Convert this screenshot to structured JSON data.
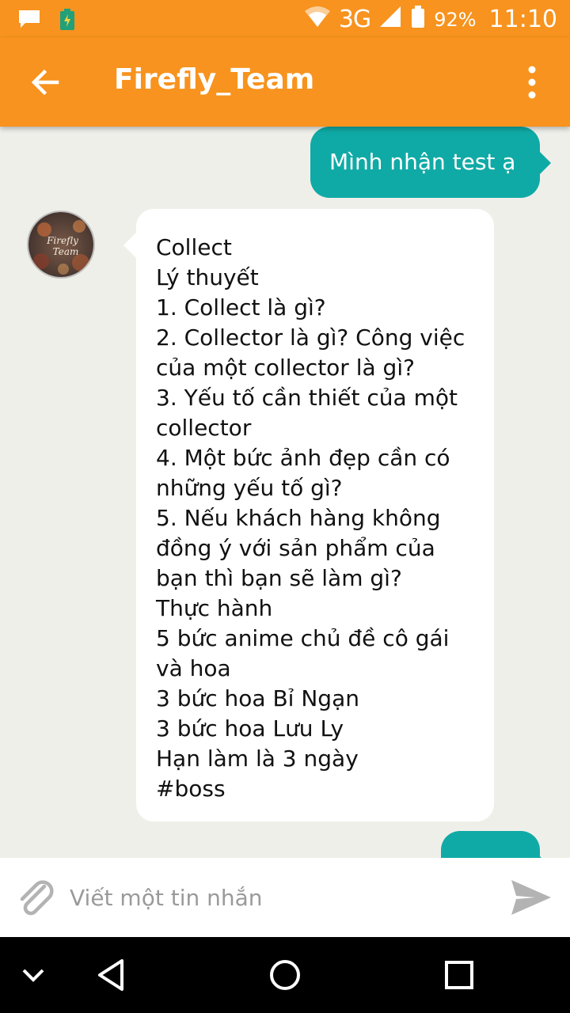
{
  "status_bar": {
    "network": "3G",
    "battery_percent": "92%",
    "time": "11:10",
    "icons": [
      "message-notification-icon",
      "battery-saver-icon",
      "wifi-icon",
      "signal-icon",
      "battery-icon"
    ]
  },
  "app_bar": {
    "title": "Firefly_Team",
    "back_icon": "arrow-left-icon",
    "menu_icon": "more-vertical-icon"
  },
  "messages": {
    "outgoing_1": "Mình nhận test ạ",
    "avatar_text": "Firefly Team",
    "incoming_lines": [
      "Collect",
      "Lý thuyết",
      "1. Collect là gì?",
      "2. Collector là gì? Công việc",
      "của một collector là gì?",
      "3. Yếu tố cần thiết của một",
      "collector",
      "4. Một bức ảnh đẹp cần có",
      "những yếu tố gì?",
      "5. Nếu khách hàng không",
      "đồng ý với sản phẩm của",
      "bạn thì bạn sẽ làm gì?",
      "Thực hành",
      "5 bức anime chủ đề cô gái",
      "và hoa",
      "3 bức hoa Bỉ Ngạn",
      "3 bức hoa Lưu Ly",
      "Hạn làm là 3 ngày",
      "#boss"
    ]
  },
  "composer": {
    "placeholder": "Viết một tin nhắn",
    "value": "",
    "attach_icon": "paperclip-icon",
    "send_icon": "send-icon"
  },
  "nav_bar": {
    "icons": [
      "chevron-down-icon",
      "back-triangle-icon",
      "home-circle-icon",
      "recents-square-icon"
    ]
  },
  "colors": {
    "accent": "#f7931e",
    "outgoing_bubble": "#10aaa6",
    "background": "#efefea"
  }
}
